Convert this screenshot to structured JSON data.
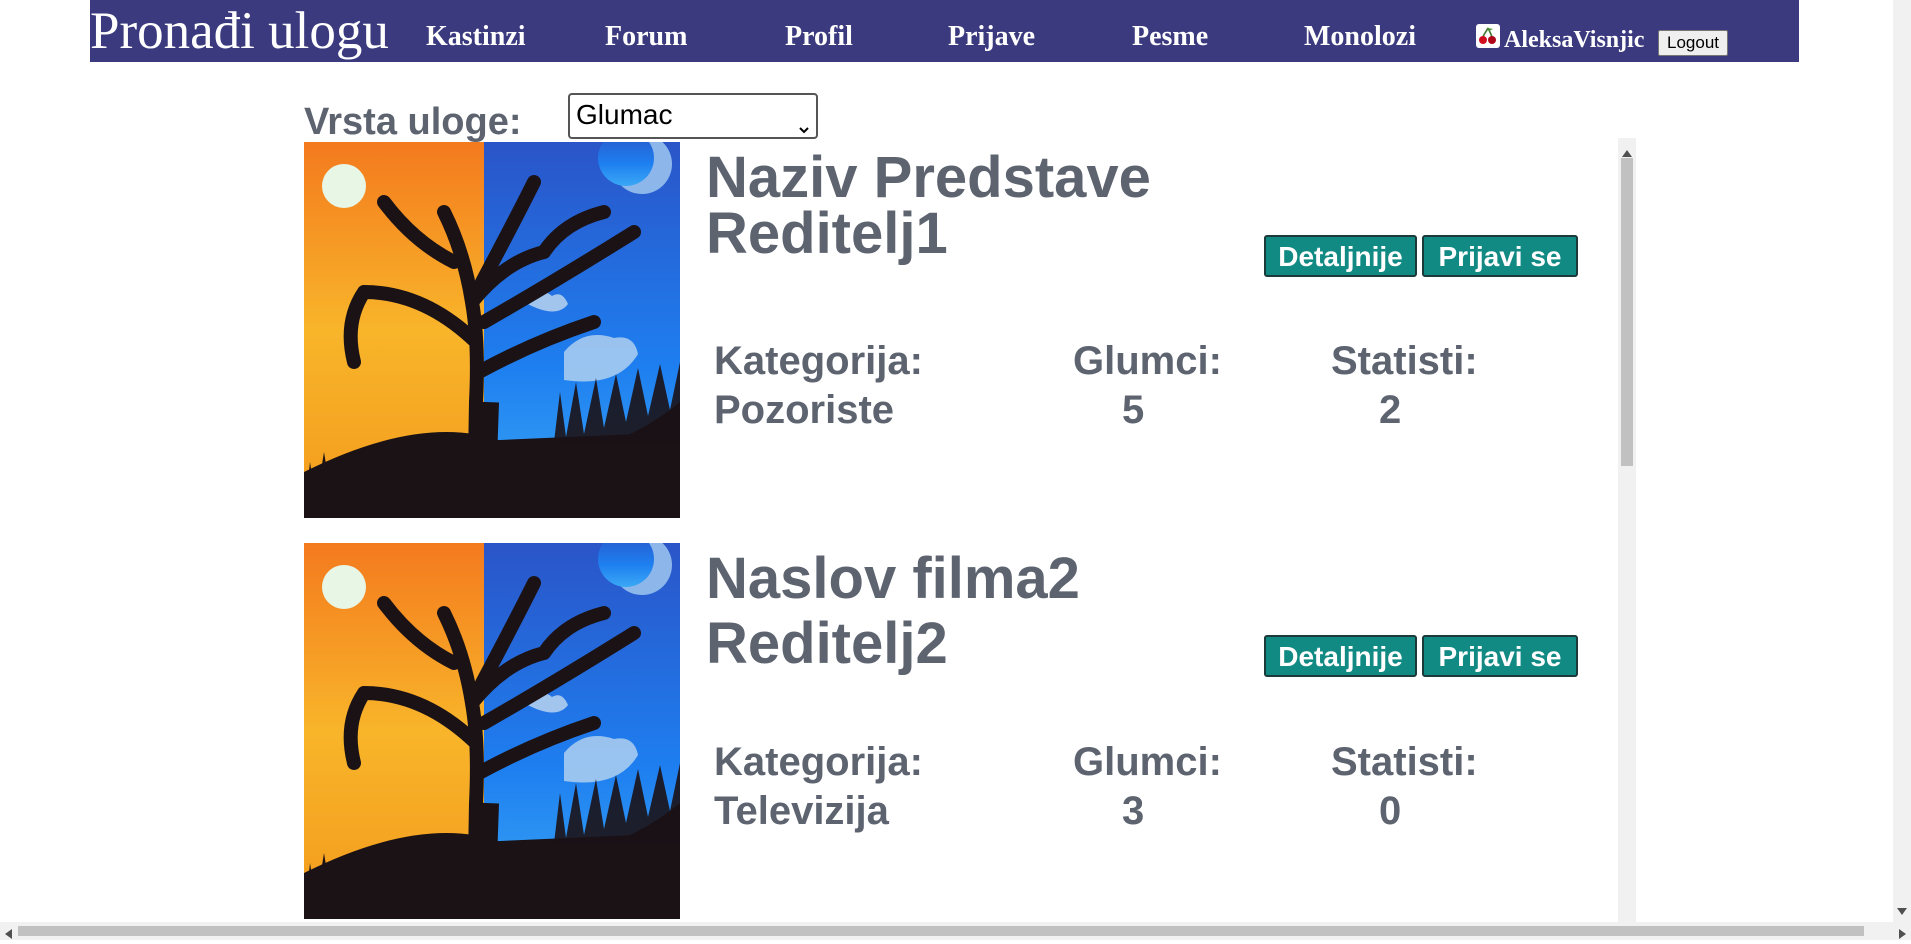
{
  "nav": {
    "brand": "Pronađi ulogu",
    "links": [
      "Kastinzi",
      "Forum",
      "Profil",
      "Prijave",
      "Pesme",
      "Monolozi"
    ],
    "username": "AleksaVisnjic",
    "logout": "Logout",
    "user_icon": "cherry-icon"
  },
  "filter": {
    "label": "Vrsta uloge:",
    "selected": "Glumac"
  },
  "labels": {
    "category": "Kategorija:",
    "actors": "Glumci:",
    "extras": "Statisti:",
    "details_button": "Detaljnije",
    "apply_button": "Prijavi se"
  },
  "listings": [
    {
      "title": "Naziv Predstave",
      "director": "Reditelj1",
      "category": "Pozoriste",
      "actors": "5",
      "extras": "2"
    },
    {
      "title": "Naslov filma2",
      "director": "Reditelj2",
      "category": "Televizija",
      "actors": "3",
      "extras": "0"
    }
  ],
  "colors": {
    "nav_bg": "#3b3a7f",
    "button_bg": "#128a84",
    "text": "#5d6470"
  }
}
